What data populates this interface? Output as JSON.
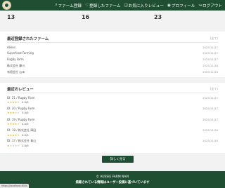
{
  "nav": {
    "items": [
      {
        "icon": "search-icon",
        "glyph": "⌕",
        "label": "ファーム登録"
      },
      {
        "icon": "heart-icon",
        "glyph": "♡",
        "label": "登録したファーム"
      },
      {
        "icon": "bookmark-icon",
        "glyph": "❏",
        "label": "お気に入りレビュー"
      },
      {
        "icon": "user-icon",
        "glyph": "◉",
        "label": "プロフィール"
      },
      {
        "icon": "logout-icon",
        "glyph": "↪",
        "label": "ログアウト"
      }
    ]
  },
  "stats": {
    "values": [
      "13",
      "16",
      "23"
    ]
  },
  "farms": {
    "title": "最近登録されたファーム",
    "more_label": "(全て)",
    "rows": [
      {
        "name": "Aliens",
        "date": "2025/11/27"
      },
      {
        "name": "Superfood Farming",
        "date": "2025/11/27"
      },
      {
        "name": "Rugby Farm",
        "date": "2025/11/27"
      },
      {
        "name": "株式会社 藤川",
        "date": "2025/11/26"
      },
      {
        "name": "有限会社 山本",
        "date": "2025/11/26"
      }
    ]
  },
  "reviews": {
    "title": "最近のレビュー",
    "more_label": "(全て)",
    "items": [
      {
        "title": "ID: 21 / Rugby Farm",
        "stars": "★★★★☆",
        "rating": "4.0/5",
        "date": "2025/11/27",
        "stars_on": 4
      },
      {
        "title": "ID: 20 / Rugby Farm",
        "stars": "★★★☆☆",
        "rating": "3.0/5",
        "date": "2025/11/27",
        "stars_on": 3
      },
      {
        "title": "ID: 19 / Rugby Farm",
        "stars": "★★★★☆",
        "rating": "4.0/5",
        "date": "2025/11/27",
        "stars_on": 4
      },
      {
        "title": "ID: 18 / 株式会社 澤田",
        "stars": "★★★★☆",
        "rating": "4.0/5",
        "date": "2025/11/26",
        "stars_on": 4
      },
      {
        "title": "ID: 17 / 株式会社 青山",
        "stars": "★☆☆☆☆",
        "rating": "1.0/5",
        "date": "2025/11/26",
        "stars_on": 1
      }
    ]
  },
  "detail_button": "詳しく見る",
  "footer": {
    "line1": "© AUSSIE FARM NAVI",
    "line2": "掲載されている情報はユーザー投稿に基づいています"
  },
  "status_url": "https://localhost:8000"
}
